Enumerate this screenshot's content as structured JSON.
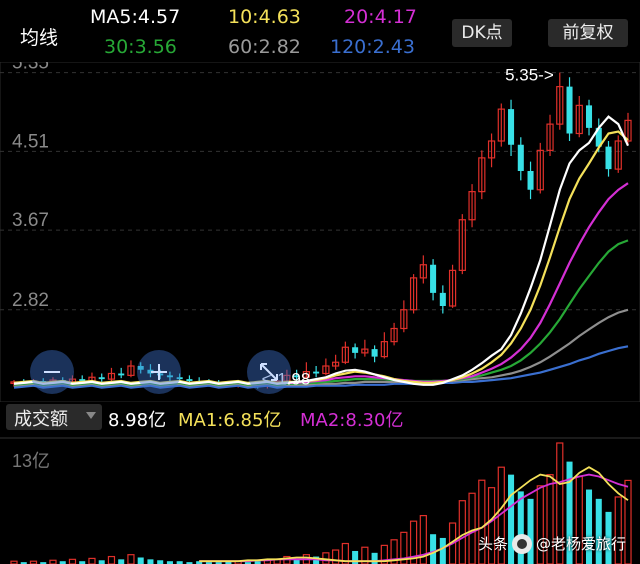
{
  "header": {
    "title": "均线",
    "ma5": "MA5:4.57",
    "ma10": "10:4.63",
    "ma20": "20:4.17",
    "ma30": "30:3.56",
    "ma60": "60:2.82",
    "ma120": "120:2.43",
    "dk_button": "DK点",
    "fq_button": "前复权"
  },
  "colors": {
    "up": "#e0302a",
    "down": "#38e0e6",
    "ma5": "#ffffff",
    "ma10": "#f4e15a",
    "ma20": "#d42fd4",
    "ma30": "#27a836",
    "ma60": "#8e8e8e",
    "ma120": "#3a6fd0"
  },
  "volume_bar": {
    "selector": "成交额",
    "value": "8.98亿",
    "ma1": "MA1:6.85亿",
    "ma2": "MA2:8.30亿",
    "axis_top": "13亿"
  },
  "watermark": {
    "prefix": "头条",
    "author": "@老杨爱旅行"
  },
  "chart_data": {
    "type": "candlestick",
    "y_ticks": [
      "5.35",
      "4.51",
      "3.67",
      "2.82"
    ],
    "y_tick_values": [
      5.35,
      4.51,
      3.67,
      2.82
    ],
    "ylim": [
      1.9,
      5.42
    ],
    "annotations": {
      "high": "5.35->",
      "low": "<-1.98"
    },
    "annotation_values": {
      "high": 5.35,
      "low": 1.98
    },
    "candles": [
      [
        2.04,
        2.05,
        2.0,
        2.07
      ],
      [
        2.05,
        2.03,
        2.01,
        2.08
      ],
      [
        2.03,
        2.06,
        2.01,
        2.08
      ],
      [
        2.06,
        2.04,
        2.02,
        2.09
      ],
      [
        2.04,
        2.07,
        2.02,
        2.1
      ],
      [
        2.07,
        2.05,
        2.03,
        2.1
      ],
      [
        2.05,
        2.08,
        2.03,
        2.12
      ],
      [
        2.08,
        2.06,
        2.04,
        2.12
      ],
      [
        2.06,
        2.1,
        2.04,
        2.15
      ],
      [
        2.1,
        2.08,
        2.05,
        2.14
      ],
      [
        2.08,
        2.14,
        2.06,
        2.2
      ],
      [
        2.14,
        2.12,
        2.09,
        2.2
      ],
      [
        2.12,
        2.22,
        2.1,
        2.28
      ],
      [
        2.22,
        2.18,
        2.14,
        2.26
      ],
      [
        2.18,
        2.14,
        2.1,
        2.24
      ],
      [
        2.14,
        2.12,
        2.08,
        2.18
      ],
      [
        2.12,
        2.1,
        2.06,
        2.16
      ],
      [
        2.1,
        2.08,
        2.04,
        2.14
      ],
      [
        2.08,
        2.06,
        2.03,
        2.12
      ],
      [
        2.06,
        2.05,
        2.02,
        2.1
      ],
      [
        2.05,
        2.04,
        2.01,
        2.08
      ],
      [
        2.04,
        2.03,
        2.0,
        2.07
      ],
      [
        2.03,
        2.02,
        2.0,
        2.06
      ],
      [
        2.02,
        2.03,
        1.99,
        2.06
      ],
      [
        2.03,
        2.02,
        1.99,
        2.05
      ],
      [
        2.02,
        2.01,
        1.98,
        2.05
      ],
      [
        2.01,
        2.03,
        1.98,
        2.06
      ],
      [
        2.03,
        2.06,
        2.01,
        2.1
      ],
      [
        2.06,
        2.12,
        2.04,
        2.18
      ],
      [
        2.12,
        2.1,
        2.06,
        2.18
      ],
      [
        2.1,
        2.16,
        2.08,
        2.26
      ],
      [
        2.16,
        2.14,
        2.1,
        2.22
      ],
      [
        2.14,
        2.22,
        2.12,
        2.3
      ],
      [
        2.22,
        2.26,
        2.18,
        2.34
      ],
      [
        2.26,
        2.42,
        2.24,
        2.48
      ],
      [
        2.42,
        2.36,
        2.3,
        2.46
      ],
      [
        2.36,
        2.4,
        2.32,
        2.5
      ],
      [
        2.4,
        2.32,
        2.26,
        2.44
      ],
      [
        2.32,
        2.48,
        2.3,
        2.58
      ],
      [
        2.48,
        2.62,
        2.44,
        2.68
      ],
      [
        2.62,
        2.82,
        2.58,
        2.92
      ],
      [
        2.82,
        3.16,
        2.78,
        3.2
      ],
      [
        3.16,
        3.3,
        3.1,
        3.4
      ],
      [
        3.3,
        3.0,
        2.92,
        3.36
      ],
      [
        3.0,
        2.86,
        2.78,
        3.08
      ],
      [
        2.86,
        3.24,
        2.84,
        3.3
      ],
      [
        3.24,
        3.78,
        3.2,
        3.84
      ],
      [
        3.78,
        4.08,
        3.7,
        4.16
      ],
      [
        4.08,
        4.44,
        4.0,
        4.52
      ],
      [
        4.44,
        4.62,
        4.34,
        4.7
      ],
      [
        4.62,
        4.96,
        4.56,
        5.02
      ],
      [
        4.96,
        4.58,
        4.46,
        5.06
      ],
      [
        4.58,
        4.3,
        4.2,
        4.66
      ],
      [
        4.3,
        4.1,
        4.0,
        4.4
      ],
      [
        4.1,
        4.52,
        4.06,
        4.6
      ],
      [
        4.52,
        4.8,
        4.46,
        4.9
      ],
      [
        4.8,
        5.2,
        4.74,
        5.35
      ],
      [
        5.2,
        4.7,
        4.62,
        5.3
      ],
      [
        4.7,
        5.0,
        4.66,
        5.1
      ],
      [
        5.0,
        4.76,
        4.68,
        5.06
      ],
      [
        4.76,
        4.56,
        4.5,
        4.86
      ],
      [
        4.56,
        4.32,
        4.24,
        4.62
      ],
      [
        4.32,
        4.62,
        4.28,
        4.68
      ],
      [
        4.62,
        4.84,
        4.58,
        4.92
      ]
    ],
    "ma": {
      "ma5": [
        2.04,
        2.05,
        2.06,
        2.08,
        2.1,
        2.14,
        2.17,
        2.18,
        2.16,
        2.13,
        2.1,
        2.07,
        2.05,
        2.03,
        2.02,
        2.02,
        2.04,
        2.08,
        2.12,
        2.18,
        2.25,
        2.33,
        2.4,
        2.55,
        2.78,
        3.05,
        3.35,
        3.72,
        4.1,
        4.38,
        4.52,
        4.6,
        4.76,
        4.88,
        4.8,
        4.57
      ],
      "ma10": [
        2.05,
        2.05,
        2.06,
        2.07,
        2.09,
        2.12,
        2.14,
        2.16,
        2.15,
        2.13,
        2.11,
        2.08,
        2.06,
        2.05,
        2.04,
        2.04,
        2.05,
        2.07,
        2.1,
        2.14,
        2.19,
        2.26,
        2.34,
        2.46,
        2.62,
        2.82,
        3.08,
        3.38,
        3.7,
        4.0,
        4.22,
        4.38,
        4.55,
        4.7,
        4.72,
        4.63
      ],
      "ma20": [
        2.04,
        2.04,
        2.05,
        2.06,
        2.07,
        2.09,
        2.1,
        2.11,
        2.11,
        2.1,
        2.09,
        2.08,
        2.07,
        2.06,
        2.05,
        2.05,
        2.06,
        2.07,
        2.09,
        2.11,
        2.15,
        2.19,
        2.24,
        2.31,
        2.4,
        2.52,
        2.68,
        2.88,
        3.1,
        3.32,
        3.52,
        3.7,
        3.86,
        4.0,
        4.1,
        4.17
      ],
      "ma30": [
        2.03,
        2.03,
        2.04,
        2.04,
        2.05,
        2.06,
        2.07,
        2.08,
        2.08,
        2.08,
        2.08,
        2.07,
        2.07,
        2.06,
        2.06,
        2.06,
        2.06,
        2.07,
        2.08,
        2.1,
        2.12,
        2.15,
        2.18,
        2.22,
        2.28,
        2.36,
        2.46,
        2.58,
        2.72,
        2.88,
        3.04,
        3.18,
        3.32,
        3.44,
        3.52,
        3.56
      ],
      "ma60": [
        2.02,
        2.02,
        2.02,
        2.03,
        2.03,
        2.03,
        2.04,
        2.04,
        2.05,
        2.05,
        2.05,
        2.05,
        2.05,
        2.05,
        2.05,
        2.06,
        2.06,
        2.06,
        2.07,
        2.08,
        2.09,
        2.1,
        2.12,
        2.14,
        2.17,
        2.21,
        2.26,
        2.32,
        2.39,
        2.46,
        2.54,
        2.61,
        2.68,
        2.74,
        2.79,
        2.82
      ],
      "ma120": [
        2.0,
        2.0,
        2.0,
        2.01,
        2.01,
        2.01,
        2.01,
        2.02,
        2.02,
        2.02,
        2.02,
        2.03,
        2.03,
        2.03,
        2.03,
        2.04,
        2.04,
        2.04,
        2.05,
        2.05,
        2.06,
        2.07,
        2.08,
        2.09,
        2.11,
        2.13,
        2.15,
        2.18,
        2.21,
        2.24,
        2.28,
        2.31,
        2.35,
        2.38,
        2.41,
        2.43
      ]
    },
    "volume": {
      "ylim": [
        0,
        13
      ],
      "values": [
        0.3,
        0.2,
        0.3,
        0.2,
        0.4,
        0.3,
        0.5,
        0.3,
        0.6,
        0.4,
        0.8,
        0.5,
        1.0,
        0.7,
        0.5,
        0.4,
        0.3,
        0.3,
        0.2,
        0.3,
        0.2,
        0.2,
        0.3,
        0.3,
        0.2,
        0.3,
        0.4,
        0.5,
        0.8,
        0.6,
        1.0,
        0.8,
        1.2,
        1.5,
        2.2,
        1.4,
        1.8,
        1.2,
        2.0,
        2.6,
        3.4,
        4.6,
        5.2,
        3.2,
        2.8,
        4.4,
        6.8,
        7.6,
        9.0,
        8.2,
        10.4,
        9.6,
        7.8,
        7.0,
        8.4,
        9.6,
        13.0,
        11.0,
        9.4,
        8.0,
        7.0,
        5.6,
        7.2,
        8.98
      ],
      "ma1": [
        0.3,
        0.3,
        0.3,
        0.3,
        0.3,
        0.4,
        0.4,
        0.5,
        0.5,
        0.6,
        0.7,
        0.7,
        0.6,
        0.5,
        0.4,
        0.3,
        0.3,
        0.3,
        0.3,
        0.3,
        0.4,
        0.5,
        0.6,
        0.8,
        1.2,
        1.7,
        2.4,
        3.1,
        3.6,
        3.9,
        4.8,
        6.0,
        7.4,
        8.2,
        9.0,
        9.6,
        9.4,
        8.6,
        8.8,
        9.8,
        10.4,
        9.8,
        8.6,
        7.6,
        6.85
      ],
      "ma2": [
        0.3,
        0.3,
        0.3,
        0.3,
        0.3,
        0.3,
        0.4,
        0.4,
        0.5,
        0.5,
        0.5,
        0.5,
        0.5,
        0.4,
        0.4,
        0.3,
        0.3,
        0.3,
        0.3,
        0.4,
        0.5,
        0.6,
        0.8,
        1.0,
        1.3,
        1.7,
        2.2,
        2.8,
        3.4,
        3.9,
        4.6,
        5.4,
        6.2,
        7.0,
        7.6,
        8.2,
        8.6,
        8.8,
        9.1,
        9.4,
        9.6,
        9.4,
        9.0,
        8.6,
        8.3
      ]
    }
  }
}
